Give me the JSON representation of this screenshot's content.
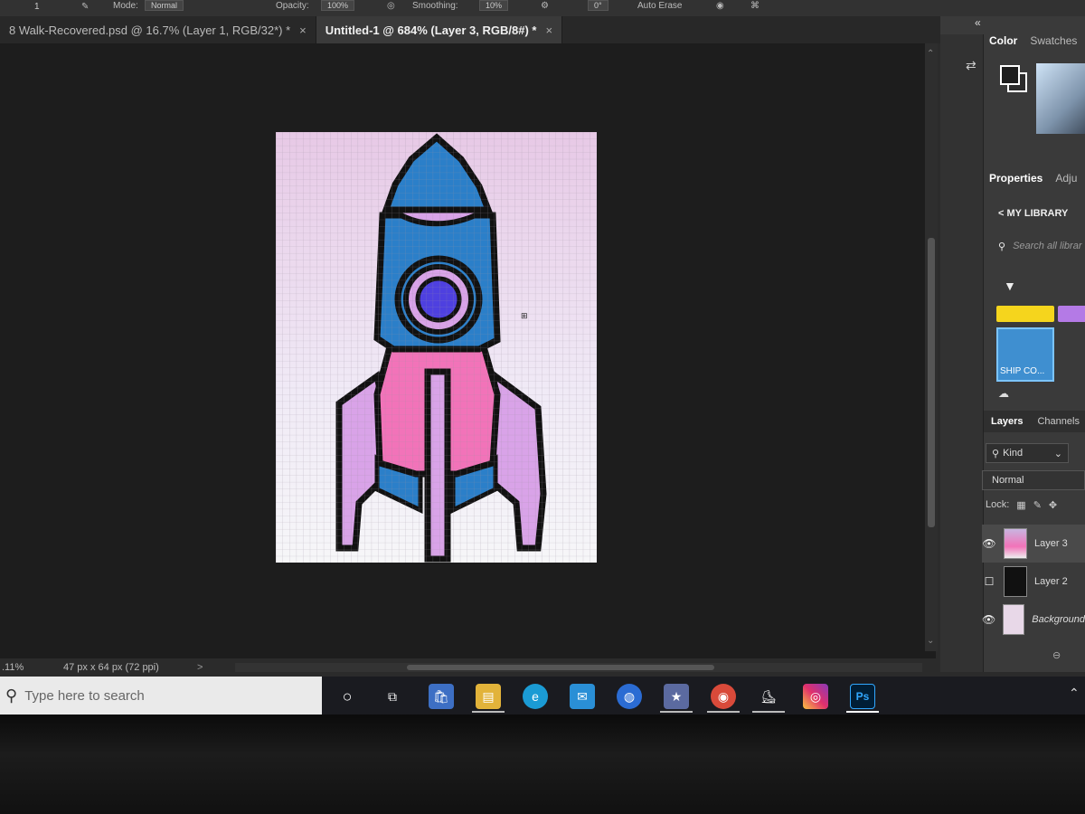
{
  "options_bar": {
    "number_label": "1",
    "mode_label": "Mode:",
    "mode_value": "Normal",
    "opacity_label": "Opacity:",
    "opacity_value": "100%",
    "smoothing_label": "Smoothing:",
    "smoothing_value": "10%",
    "angle_value": "0°",
    "auto_erase_label": "Auto Erase"
  },
  "tabs": [
    {
      "label": "8 Walk-Recovered.psd @ 16.7% (Layer 1, RGB/32*) *"
    },
    {
      "label": "Untitled-1 @ 684% (Layer 3, RGB/8#) *"
    }
  ],
  "tab_close": "×",
  "status_bar": {
    "zoom": ".11%",
    "dimensions": "47 px x 64 px (72 ppi)",
    "arrow": ">"
  },
  "panels": {
    "collapse_icon": "«",
    "color_tab": "Color",
    "swatches_tab": "Swatches",
    "properties_tab": "Properties",
    "adjustments_tab": "Adju",
    "library_back": "<",
    "library_title": "MY LIBRARY",
    "search_placeholder": "Search all librar",
    "library_card_label": "SHIP CO...",
    "layers_tab": "Layers",
    "channels_tab": "Channels",
    "kind_label": "Kind",
    "blend_mode": "Normal",
    "lock_label": "Lock:",
    "layers": [
      {
        "name": "Layer 3",
        "visible": true,
        "selected": true
      },
      {
        "name": "Layer 2",
        "visible": false,
        "selected": false
      },
      {
        "name": "Background",
        "visible": true,
        "selected": false
      }
    ]
  },
  "taskbar": {
    "search_placeholder": "Type here to search",
    "apps": [
      "cortana",
      "task-view",
      "store",
      "file-explorer",
      "edge",
      "mail",
      "outlook-app",
      "movie-maker",
      "chrome",
      "skating-app",
      "instagram",
      "photoshop"
    ],
    "photoshop_label": "Ps"
  },
  "colors": {
    "rocket_outline": "#111111",
    "rocket_blue": "#2b7fc9",
    "rocket_pink": "#f273b9",
    "rocket_lilac": "#d9a3e8",
    "window_violet": "#4e40e0"
  }
}
